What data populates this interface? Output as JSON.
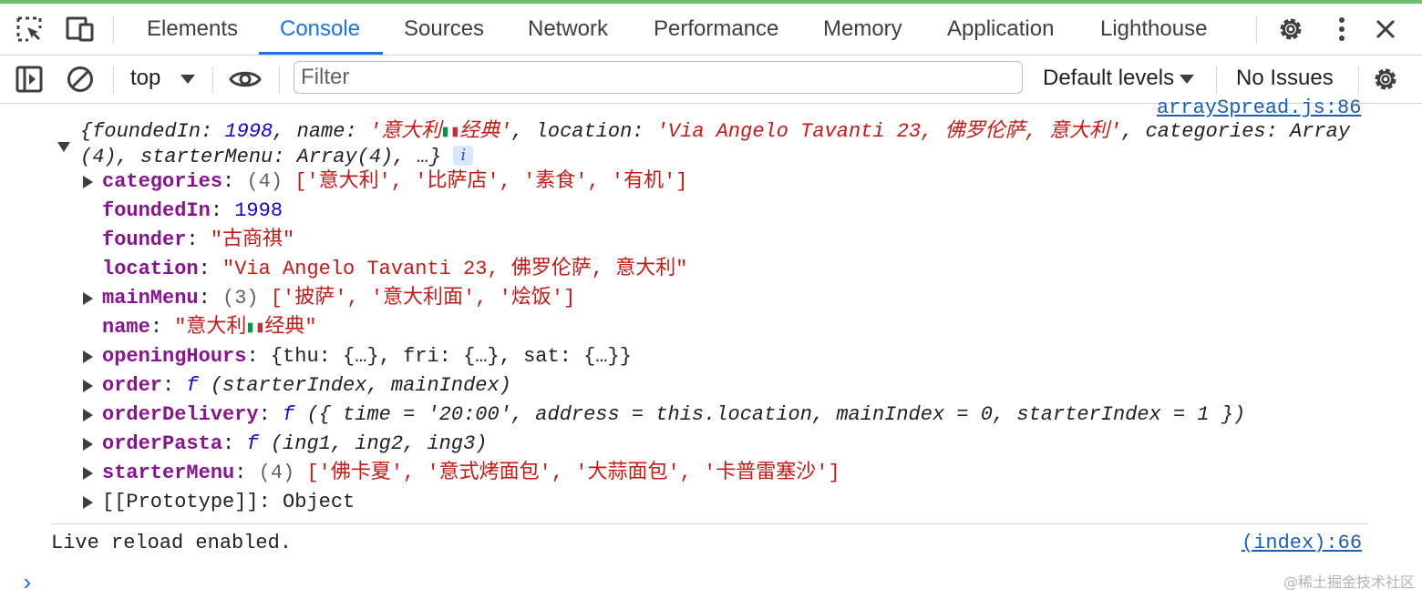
{
  "tabs": {
    "elements": "Elements",
    "console": "Console",
    "sources": "Sources",
    "network": "Network",
    "performance": "Performance",
    "memory": "Memory",
    "application": "Application",
    "lighthouse": "Lighthouse"
  },
  "toolbar": {
    "context": "top",
    "filter_placeholder": "Filter",
    "levels": "Default levels",
    "issues": "No Issues"
  },
  "log": {
    "source_link": "arraySpread.js:86",
    "summary_line1_prefix": "{foundedIn: ",
    "summary_founded": "1998",
    "summary_name_key": ", name: ",
    "summary_name_val": "'意大利",
    "summary_name_val_end": "经典'",
    "summary_location_key": ", location: ",
    "summary_location_val": "'Via Angelo Tavanti 23, 佛罗伦萨, 意大利'",
    "summary_categories_key": ", categories: ",
    "summary_categories_val": "Array",
    "summary_line2": "(4), starterMenu: Array(4), …}",
    "info_badge": "i",
    "props": [
      {
        "key": "categories",
        "count": "(4)",
        "value": "['意大利', '比萨店', '素食', '有机']"
      },
      {
        "key": "foundedIn",
        "value": "1998"
      },
      {
        "key": "founder",
        "value": "\"古商祺\""
      },
      {
        "key": "location",
        "value": "\"Via Angelo Tavanti 23, 佛罗伦萨, 意大利\""
      },
      {
        "key": "mainMenu",
        "count": "(3)",
        "value": "['披萨', '意大利面', '烩饭']"
      },
      {
        "key": "name",
        "value_prefix": "\"意大利",
        "value_suffix": "经典\""
      },
      {
        "key": "openingHours",
        "value": "{thu: {…}, fri: {…}, sat: {…}}"
      },
      {
        "key": "order",
        "fn": "f",
        "value": "(starterIndex, mainIndex)"
      },
      {
        "key": "orderDelivery",
        "fn": "f",
        "value": "({ time = '20:00', address = this.location, mainIndex = 0, starterIndex = 1 })"
      },
      {
        "key": "orderPasta",
        "fn": "f",
        "value": "(ing1, ing2, ing3)"
      },
      {
        "key": "starterMenu",
        "count": "(4)",
        "value": "['佛卡夏', '意式烤面包', '大蒜面包', '卡普雷塞沙']"
      },
      {
        "key": "[[Prototype]]",
        "value": "Object"
      }
    ]
  },
  "live_reload": {
    "message": "Live reload enabled.",
    "source_link": "(index):66"
  },
  "prompt": "›",
  "watermark": "@稀土掘金技术社区",
  "colors": {
    "accent": "#1a73e8",
    "key": "#881391",
    "string": "#c41a16",
    "number": "#1c00cf"
  }
}
